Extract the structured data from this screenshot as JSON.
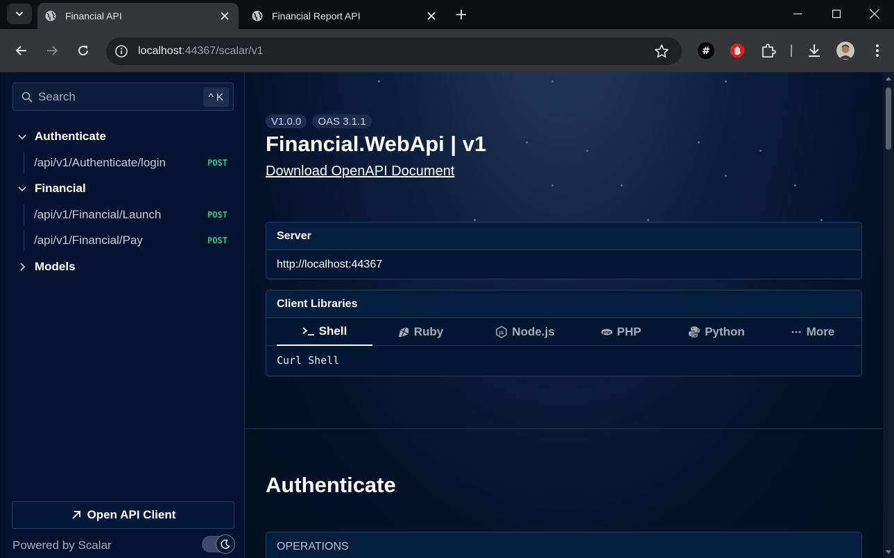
{
  "browser": {
    "tabs": [
      {
        "title": "Financial API",
        "active": true
      },
      {
        "title": "Financial Report API",
        "active": false
      }
    ],
    "url_host": "localhost",
    "url_rest": ":44367/scalar/v1",
    "extensions": [
      "hashtag-icon",
      "stop-hand-icon",
      "puzzle-icon",
      "download-icon",
      "profile-avatar",
      "kebab-menu-icon"
    ]
  },
  "sidebar": {
    "search_placeholder": "Search",
    "search_shortcut": "^ K",
    "groups": [
      {
        "label": "Authenticate",
        "expanded": true,
        "items": [
          {
            "path": "/api/v1/Authenticate/login",
            "method": "POST"
          }
        ]
      },
      {
        "label": "Financial",
        "expanded": true,
        "items": [
          {
            "path": "/api/v1/Financial/Launch",
            "method": "POST"
          },
          {
            "path": "/api/v1/Financial/Pay",
            "method": "POST"
          }
        ]
      },
      {
        "label": "Models",
        "expanded": false,
        "items": []
      }
    ],
    "open_client_label": "Open API Client",
    "powered_by": "Powered by Scalar"
  },
  "content": {
    "version": "V1.0.0",
    "oas": "OAS 3.1.1",
    "title": "Financial.WebApi | v1",
    "download_link": "Download OpenAPI Document",
    "server_heading": "Server",
    "server_url": "http://localhost:44367",
    "client_libraries_heading": "Client Libraries",
    "languages": [
      {
        "label": "Shell",
        "active": true
      },
      {
        "label": "Ruby",
        "active": false
      },
      {
        "label": "Node.js",
        "active": false
      },
      {
        "label": "PHP",
        "active": false
      },
      {
        "label": "Python",
        "active": false
      },
      {
        "label": "More",
        "active": false
      }
    ],
    "code_snippet": "Curl Shell",
    "section_title": "Authenticate",
    "operations_label": "OPERATIONS"
  },
  "colors": {
    "accent_post": "#27c98b",
    "page_bg": "#010f24",
    "sidebar_bg": "#01132e"
  }
}
